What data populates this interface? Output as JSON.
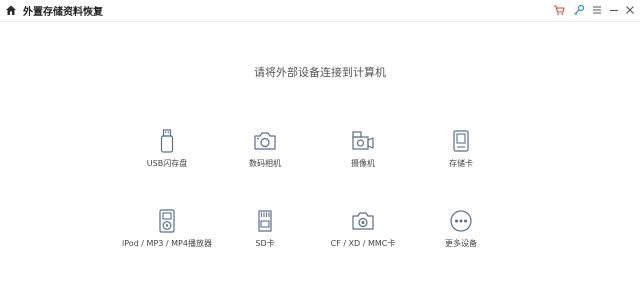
{
  "app": {
    "title": "外置存储资料恢复",
    "accent_color": "#5a6f8a"
  },
  "toolbar": {
    "icons": [
      "cart-icon",
      "key-icon",
      "menu-icon",
      "minimize-icon",
      "close-icon"
    ],
    "cart_color": "#e0492f",
    "key_color": "#2f8fd8"
  },
  "main": {
    "heading": "请将外部设备连接到计算机",
    "devices": [
      {
        "label": "USB闪存盘",
        "icon": "usb-drive-icon"
      },
      {
        "label": "数码相机",
        "icon": "camera-icon"
      },
      {
        "label": "摄像机",
        "icon": "video-camera-icon"
      },
      {
        "label": "存储卡",
        "icon": "memory-card-icon"
      },
      {
        "label": "iPod / MP3 / MP4播放器",
        "icon": "media-player-icon"
      },
      {
        "label": "SD卡",
        "icon": "sd-card-icon"
      },
      {
        "label": "CF / XD / MMC卡",
        "icon": "cf-card-icon"
      },
      {
        "label": "更多设备",
        "icon": "more-devices-icon"
      }
    ]
  }
}
